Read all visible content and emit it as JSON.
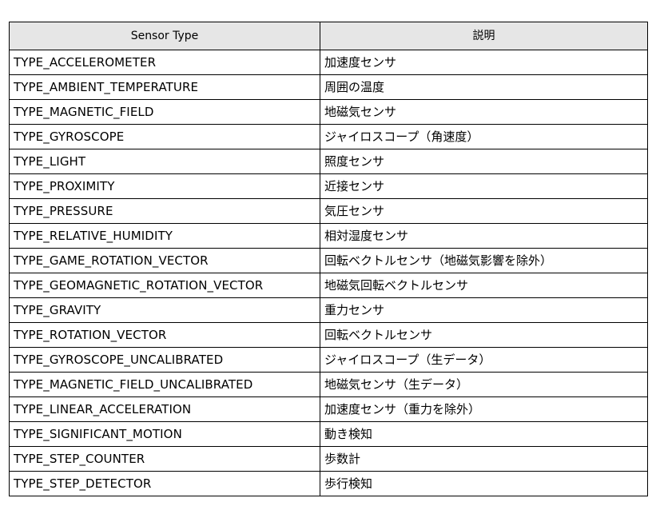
{
  "table": {
    "headers": [
      "Sensor Type",
      "説明"
    ],
    "rows": [
      [
        "TYPE_ACCELEROMETER",
        "加速度センサ"
      ],
      [
        "TYPE_AMBIENT_TEMPERATURE",
        "周囲の温度"
      ],
      [
        "TYPE_MAGNETIC_FIELD",
        "地磁気センサ"
      ],
      [
        "TYPE_GYROSCOPE",
        "ジャイロスコープ（角速度）"
      ],
      [
        "TYPE_LIGHT",
        "照度センサ"
      ],
      [
        "TYPE_PROXIMITY",
        "近接センサ"
      ],
      [
        "TYPE_PRESSURE",
        "気圧センサ"
      ],
      [
        "TYPE_RELATIVE_HUMIDITY",
        "相対湿度センサ"
      ],
      [
        "TYPE_GAME_ROTATION_VECTOR",
        "回転ベクトルセンサ（地磁気影響を除外）"
      ],
      [
        "TYPE_GEOMAGNETIC_ROTATION_VECTOR",
        "地磁気回転ベクトルセンサ"
      ],
      [
        "TYPE_GRAVITY",
        "重力センサ"
      ],
      [
        "TYPE_ROTATION_VECTOR",
        "回転ベクトルセンサ"
      ],
      [
        "TYPE_GYROSCOPE_UNCALIBRATED",
        "ジャイロスコープ（生データ）"
      ],
      [
        "TYPE_MAGNETIC_FIELD_UNCALIBRATED",
        "地磁気センサ（生データ）"
      ],
      [
        "TYPE_LINEAR_ACCELERATION",
        "加速度センサ（重力を除外）"
      ],
      [
        "TYPE_SIGNIFICANT_MOTION",
        "動き検知"
      ],
      [
        "TYPE_STEP_COUNTER",
        "歩数計"
      ],
      [
        "TYPE_STEP_DETECTOR",
        "歩行検知"
      ]
    ]
  },
  "colors": {
    "header_background": "#e6e6e6",
    "border": "#000000"
  }
}
